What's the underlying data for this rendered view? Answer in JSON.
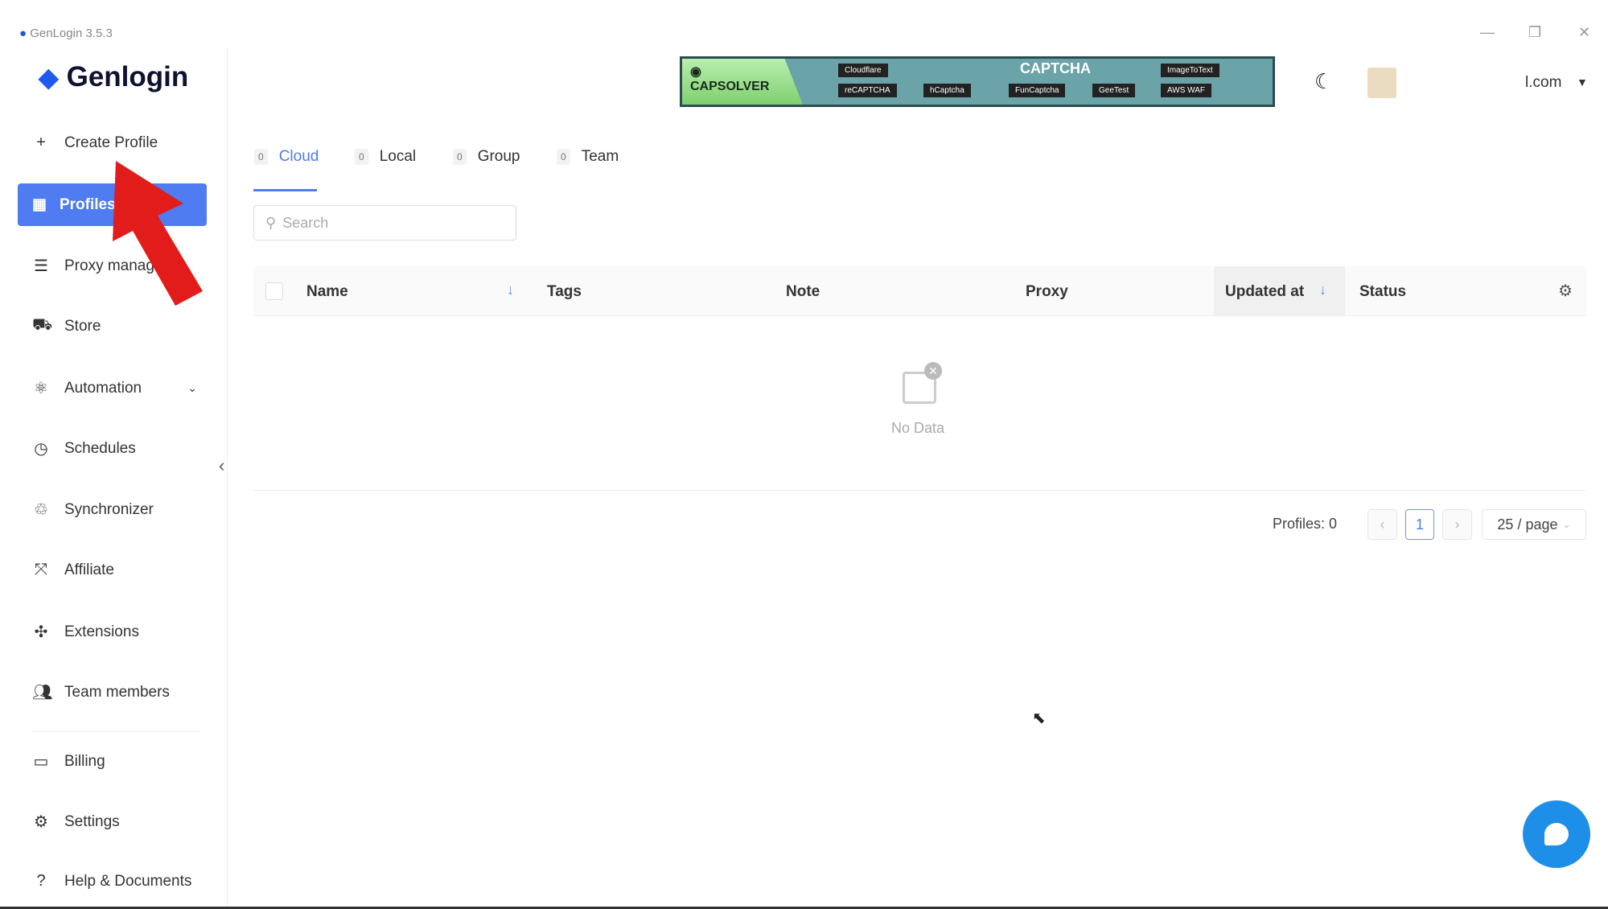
{
  "window": {
    "title": "GenLogin 3.5.3"
  },
  "brand": {
    "name": "Genlogin"
  },
  "sidebar": {
    "create": "Create Profile",
    "items": [
      {
        "label": "Profiles",
        "icon": "grid-icon"
      },
      {
        "label": "Proxy manag",
        "icon": "server-icon"
      },
      {
        "label": "Store",
        "icon": "cart-icon"
      },
      {
        "label": "Automation",
        "icon": "automation-icon"
      },
      {
        "label": "Schedules",
        "icon": "clock-icon"
      },
      {
        "label": "Synchronizer",
        "icon": "sync-icon"
      },
      {
        "label": "Affiliate",
        "icon": "affiliate-icon"
      },
      {
        "label": "Extensions",
        "icon": "puzzle-icon"
      },
      {
        "label": "Team members",
        "icon": "users-icon"
      },
      {
        "label": "Billing",
        "icon": "card-icon"
      },
      {
        "label": "Settings",
        "icon": "gear-icon"
      },
      {
        "label": "Help & Documents",
        "icon": "help-icon"
      }
    ]
  },
  "banner": {
    "brand": "CAPSOLVER",
    "title": "CAPTCHA",
    "chips": [
      "Cloudflare",
      "reCAPTCHA",
      "hCaptcha",
      "FunCaptcha",
      "GeeTest",
      "ImageToText",
      "AWS WAF"
    ]
  },
  "header": {
    "account": "l.com"
  },
  "tabs": [
    {
      "count": "0",
      "label": "Cloud"
    },
    {
      "count": "0",
      "label": "Local"
    },
    {
      "count": "0",
      "label": "Group"
    },
    {
      "count": "0",
      "label": "Team"
    }
  ],
  "search": {
    "placeholder": "Search"
  },
  "table": {
    "columns": [
      "Name",
      "Tags",
      "Note",
      "Proxy",
      "Updated at",
      "Status"
    ],
    "empty": "No Data"
  },
  "pagination": {
    "total": "Profiles: 0",
    "page": "1",
    "size": "25 / page"
  },
  "colors": {
    "accent": "#4f7cf0",
    "annotation": "#e21b1b",
    "chat": "#1e8fe8"
  }
}
